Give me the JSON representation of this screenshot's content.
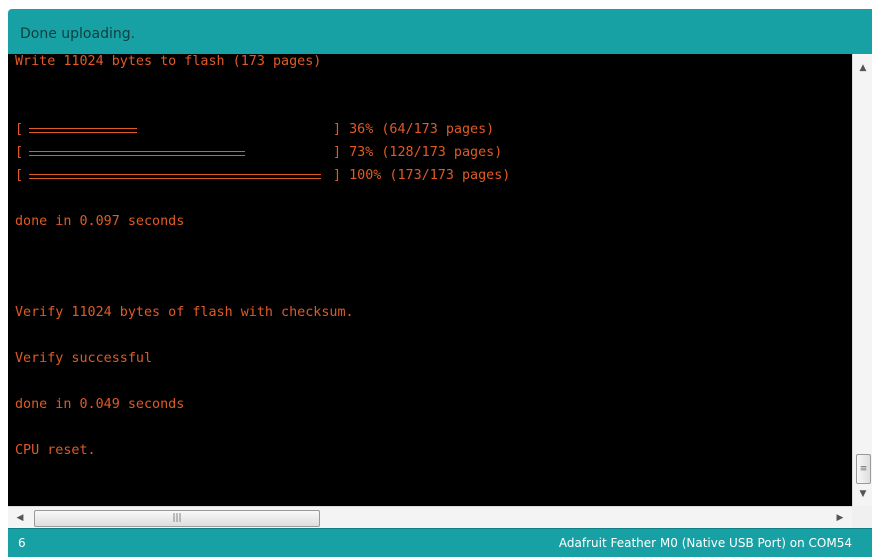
{
  "status": {
    "message": "Done uploading."
  },
  "console": {
    "lines": [
      "Write 11024 bytes to flash (173 pages)",
      "done in 0.097 seconds",
      "Verify 11024 bytes of flash with checksum.",
      "Verify successful",
      "done in 0.049 seconds",
      "CPU reset."
    ],
    "progress": [
      {
        "fraction": 0.37,
        "text": "] 36% (64/173 pages)"
      },
      {
        "fraction": 0.74,
        "text": "] 73% (128/173 pages)"
      },
      {
        "fraction": 1.0,
        "text": "] 100% (173/173 pages)"
      }
    ]
  },
  "footer": {
    "line_number": "6",
    "board": "Adafruit Feather M0 (Native USB Port) on COM54"
  },
  "colors": {
    "console_text": "#e05a24",
    "console_bg": "#000000",
    "status_bar": "#17a1a5"
  },
  "icons": {
    "up": "scroll-up-arrow-icon",
    "down": "scroll-down-arrow-icon",
    "left": "scroll-left-arrow-icon",
    "right": "scroll-right-arrow-icon"
  }
}
